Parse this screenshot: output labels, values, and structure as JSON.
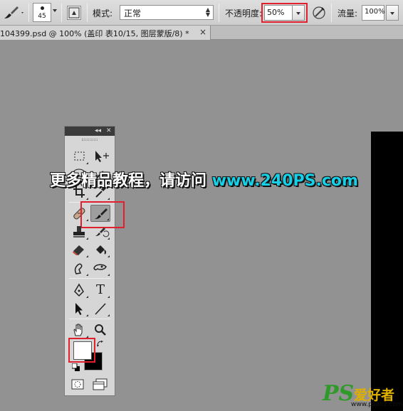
{
  "options_bar": {
    "brush_size": "45",
    "mode_label": "模式:",
    "mode_value": "正常",
    "opacity_label": "不透明度:",
    "opacity_value": "50%",
    "flow_label": "流量:",
    "flow_value": "100%"
  },
  "document": {
    "tab_title": "104399.psd @ 100% (盖印 表10/15, 图层蒙版/8) *",
    "close_label": "×"
  },
  "tools_panel": {
    "collapse_label": "◂◂",
    "close_label": "✕",
    "type_tool_label": "T",
    "tools": [
      "marquee-tool",
      "move-tool",
      "lasso-tool",
      "magic-wand-tool",
      "crop-tool",
      "eyedropper-tool",
      "healing-brush-tool",
      "brush-tool",
      "clone-stamp-tool",
      "history-brush-tool",
      "eraser-tool",
      "paint-bucket-tool",
      "blur-tool",
      "dodge-tool",
      "pen-tool",
      "type-tool",
      "path-selection-tool",
      "line-tool",
      "hand-tool",
      "zoom-tool"
    ],
    "active_tool": "brush-tool"
  },
  "colors": {
    "foreground": "#ffffff",
    "background": "#000000",
    "highlight": "#e0202c",
    "banner_url": "#16d0e8"
  },
  "watermark": {
    "banner_text": "更多精品教程，请访问 ",
    "banner_url": "www.240PS.com",
    "logo_ps": "PS",
    "logo_cn": "爱好者",
    "logo_url": "www.psahz.com"
  }
}
